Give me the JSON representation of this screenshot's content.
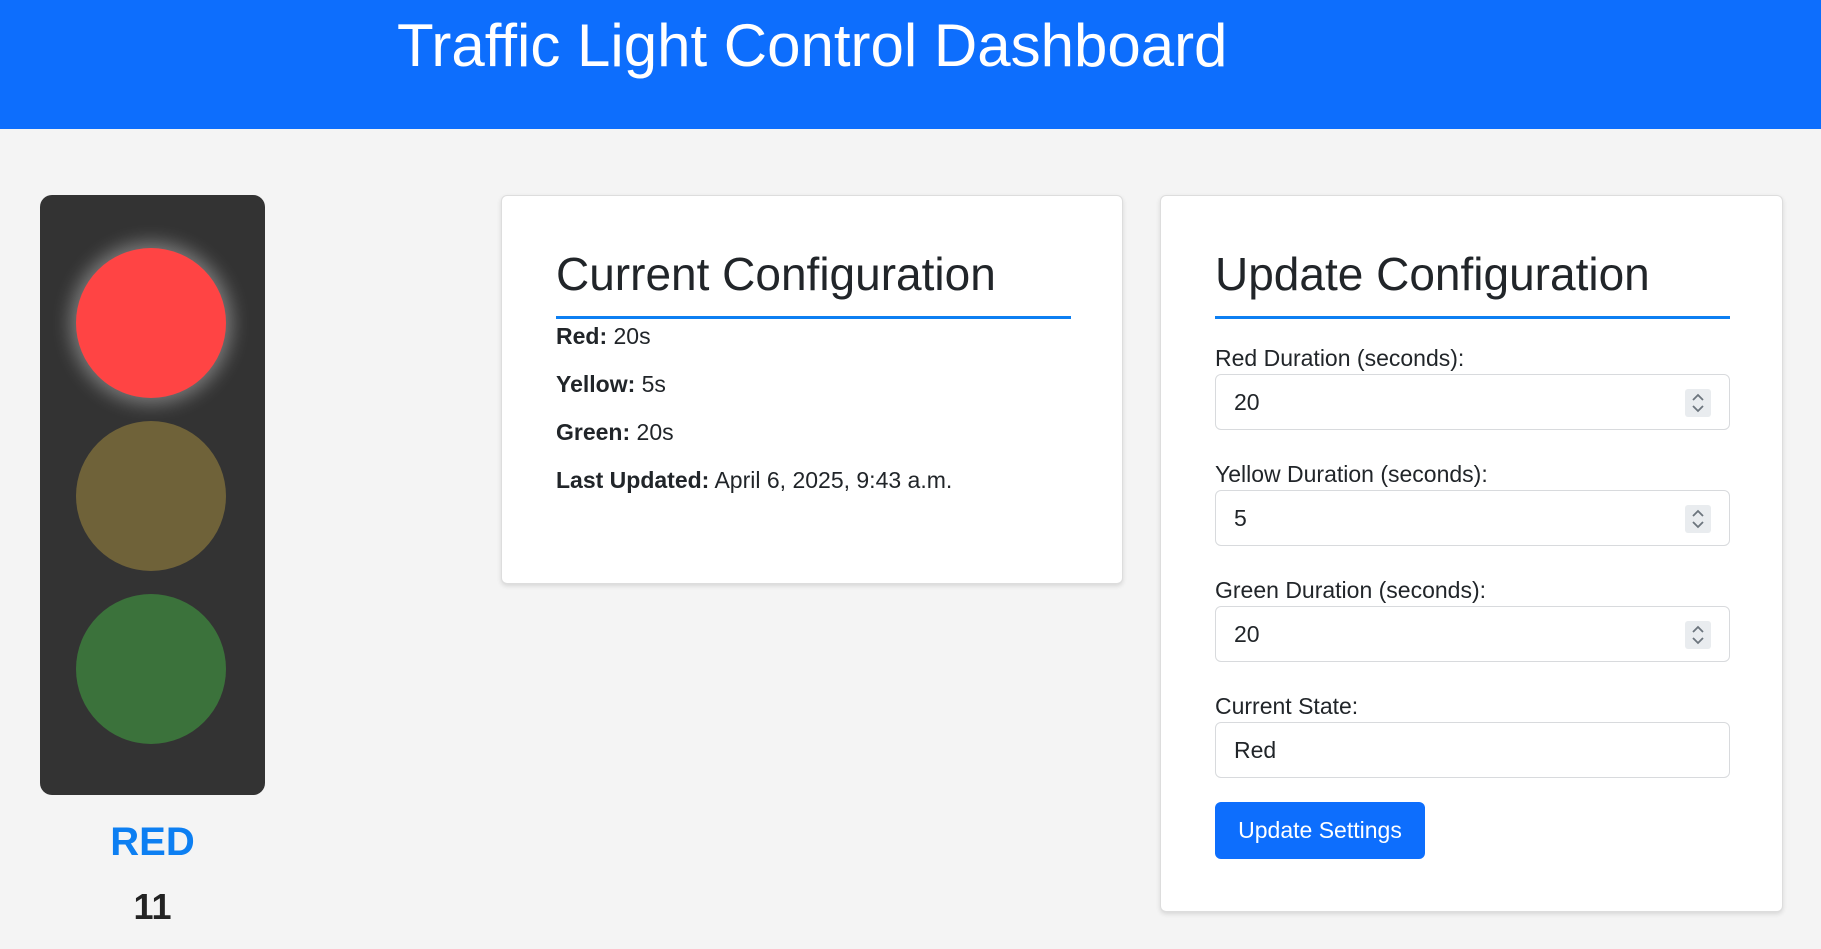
{
  "header": {
    "title": "Traffic Light Control Dashboard"
  },
  "traffic_light": {
    "active_lamp": "red",
    "lamps": [
      {
        "name": "red",
        "color": "#ff4444",
        "lit": true
      },
      {
        "name": "yellow",
        "color": "#6f6239",
        "lit": false
      },
      {
        "name": "green",
        "color": "#3b723b",
        "lit": false
      }
    ],
    "state_label": "RED",
    "countdown": "11"
  },
  "current_config": {
    "title": "Current Configuration",
    "rows": [
      {
        "label": "Red:",
        "value": "20s"
      },
      {
        "label": "Yellow:",
        "value": "5s"
      },
      {
        "label": "Green:",
        "value": "20s"
      },
      {
        "label": "Last Updated:",
        "value": "April 6, 2025, 9:43 a.m."
      }
    ]
  },
  "update_config": {
    "title": "Update Configuration",
    "fields": [
      {
        "label": "Red Duration (seconds):",
        "value": "20",
        "type": "number"
      },
      {
        "label": "Yellow Duration (seconds):",
        "value": "5",
        "type": "number"
      },
      {
        "label": "Green Duration (seconds):",
        "value": "20",
        "type": "number"
      },
      {
        "label": "Current State:",
        "value": "Red",
        "type": "text"
      }
    ],
    "submit_label": "Update Settings"
  },
  "colors": {
    "primary": "#0d6efd",
    "accent": "#0d7ff2",
    "background": "#f4f4f4",
    "housing": "#333333"
  }
}
